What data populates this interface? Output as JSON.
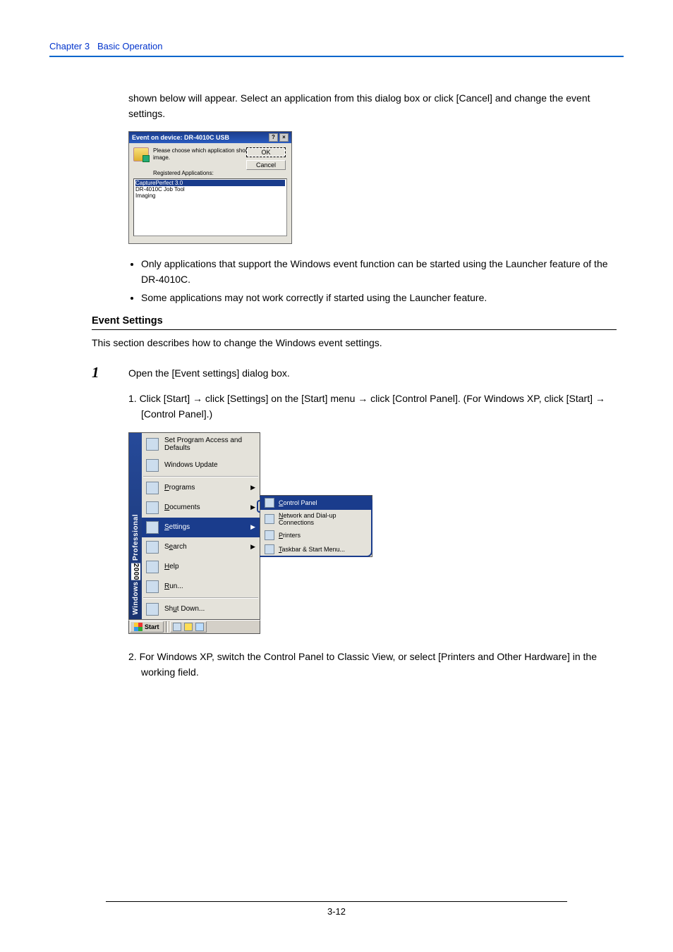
{
  "header": {
    "chapter": "Chapter 3",
    "title": "Basic Operation"
  },
  "intro_para": "shown below will appear. Select an application from this dialog box or click [Cancel] and change the event settings.",
  "event_dialog": {
    "title": "Event on  device: DR-4010C USB",
    "message": "Please choose which application should receive the image.",
    "ok": "OK",
    "cancel": "Cancel",
    "reg_label": "Registered Applications:",
    "items": [
      "CapturePerfect 3.0",
      "DR-4010C Job Tool",
      "Imaging"
    ]
  },
  "bullets": [
    "Only applications that support the Windows event function can be started using the Launcher feature of the DR-4010C.",
    "Some applications may not work correctly if started using the Launcher feature."
  ],
  "event_settings": {
    "heading": "Event Settings",
    "desc": "This section describes how to change the Windows event settings."
  },
  "step1": {
    "num": "1",
    "text": "Open the [Event settings] dialog box.",
    "sub1_prefix": "1.  Click [Start] ",
    "sub1_mid1": " click [Settings] on the [Start] menu ",
    "sub1_mid2": " click [Control Panel]. (For Windows XP, click [Start] ",
    "sub1_end": " [Control Panel].)",
    "sub2": "2.  For Windows XP, switch the Control Panel to Classic View, or select [Printers and Other Hardware] in the working field."
  },
  "start_menu": {
    "band_text": "Windows 2000 Professional",
    "items_top": [
      {
        "label": "Set Program Access and Defaults",
        "arrow": false
      },
      {
        "label": "Windows Update",
        "arrow": false
      }
    ],
    "items_main": [
      {
        "label": "Programs",
        "arrow": true,
        "underline_idx": 0
      },
      {
        "label": "Documents",
        "arrow": true,
        "underline_idx": 0
      },
      {
        "label": "Settings",
        "arrow": true,
        "hover": true,
        "underline_idx": 0
      },
      {
        "label": "Search",
        "arrow": true,
        "underline_idx": 0
      },
      {
        "label": "Help",
        "arrow": false,
        "underline_idx": 0
      },
      {
        "label": "Run...",
        "arrow": false,
        "underline_idx": 0
      }
    ],
    "items_bottom": [
      {
        "label": "Shut Down...",
        "underline_idx": 2
      }
    ],
    "submenu": [
      {
        "label": "Control Panel",
        "hover": true,
        "underline_idx": 0
      },
      {
        "label": "Network and Dial-up Connections",
        "underline_idx": 0
      },
      {
        "label": "Printers",
        "underline_idx": 0
      },
      {
        "label": "Taskbar & Start Menu...",
        "underline_idx": 0
      }
    ],
    "taskbar_start": "Start"
  },
  "page_num": "3-12",
  "arrow_glyph": "→"
}
